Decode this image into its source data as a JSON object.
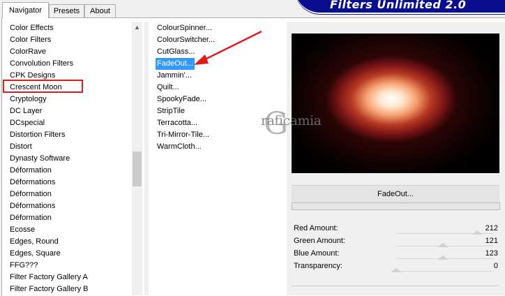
{
  "tabs": [
    {
      "label": "Navigator",
      "active": true
    },
    {
      "label": "Presets",
      "active": false
    },
    {
      "label": "About",
      "active": false
    }
  ],
  "banner": {
    "title": "Filters Unlimited 2.0",
    "color": "#0b0f8e"
  },
  "categories": {
    "items": [
      "Color Effects",
      "Color Filters",
      "ColorRave",
      "Convolution Filters",
      "CPK Designs",
      "Crescent Moon",
      "Cryptology",
      "DC Layer",
      "DCspecial",
      "Distortion Filters",
      "Distort",
      "Dynasty Software",
      "Déformation",
      "Déformations",
      "Déformation",
      "Déformations",
      "Déformation",
      "Ecosse",
      "Edges, Round",
      "Edges, Square",
      "FFG???",
      "Filter Factory Gallery A",
      "Filter Factory Gallery B"
    ],
    "highlighted": "Crescent Moon",
    "highlight_color": "#e01b1b"
  },
  "filters": {
    "items": [
      "ColourSpinner...",
      "ColourSwitcher...",
      "CutGlass...",
      "FadeOut...",
      "Jammin'...",
      "Quilt...",
      "SpookyFade...",
      "StripTile",
      "Terracotta...",
      "Tri-Mirror-Tile...",
      "WarmCloth..."
    ],
    "selected": "FadeOut...",
    "selection_color": "#3399ff"
  },
  "preview": {
    "watermark": "raficamia",
    "watermark_initial": "G"
  },
  "filter_panel": {
    "name": "FadeOut...",
    "controls": [
      {
        "label": "Red Amount:",
        "value": "212",
        "level": 0.831
      },
      {
        "label": "Green Amount:",
        "value": "121",
        "level": 0.475
      },
      {
        "label": "Blue Amount:",
        "value": "123",
        "level": 0.482
      },
      {
        "label": "Transparency:",
        "value": "0",
        "level": 0
      }
    ]
  },
  "icons": {
    "scroll_up": "chevron-up-icon",
    "annotation_arrow": "red-arrow-icon"
  },
  "colors": {
    "arrow": "#e01b1b",
    "tab_border": "#adadad"
  }
}
